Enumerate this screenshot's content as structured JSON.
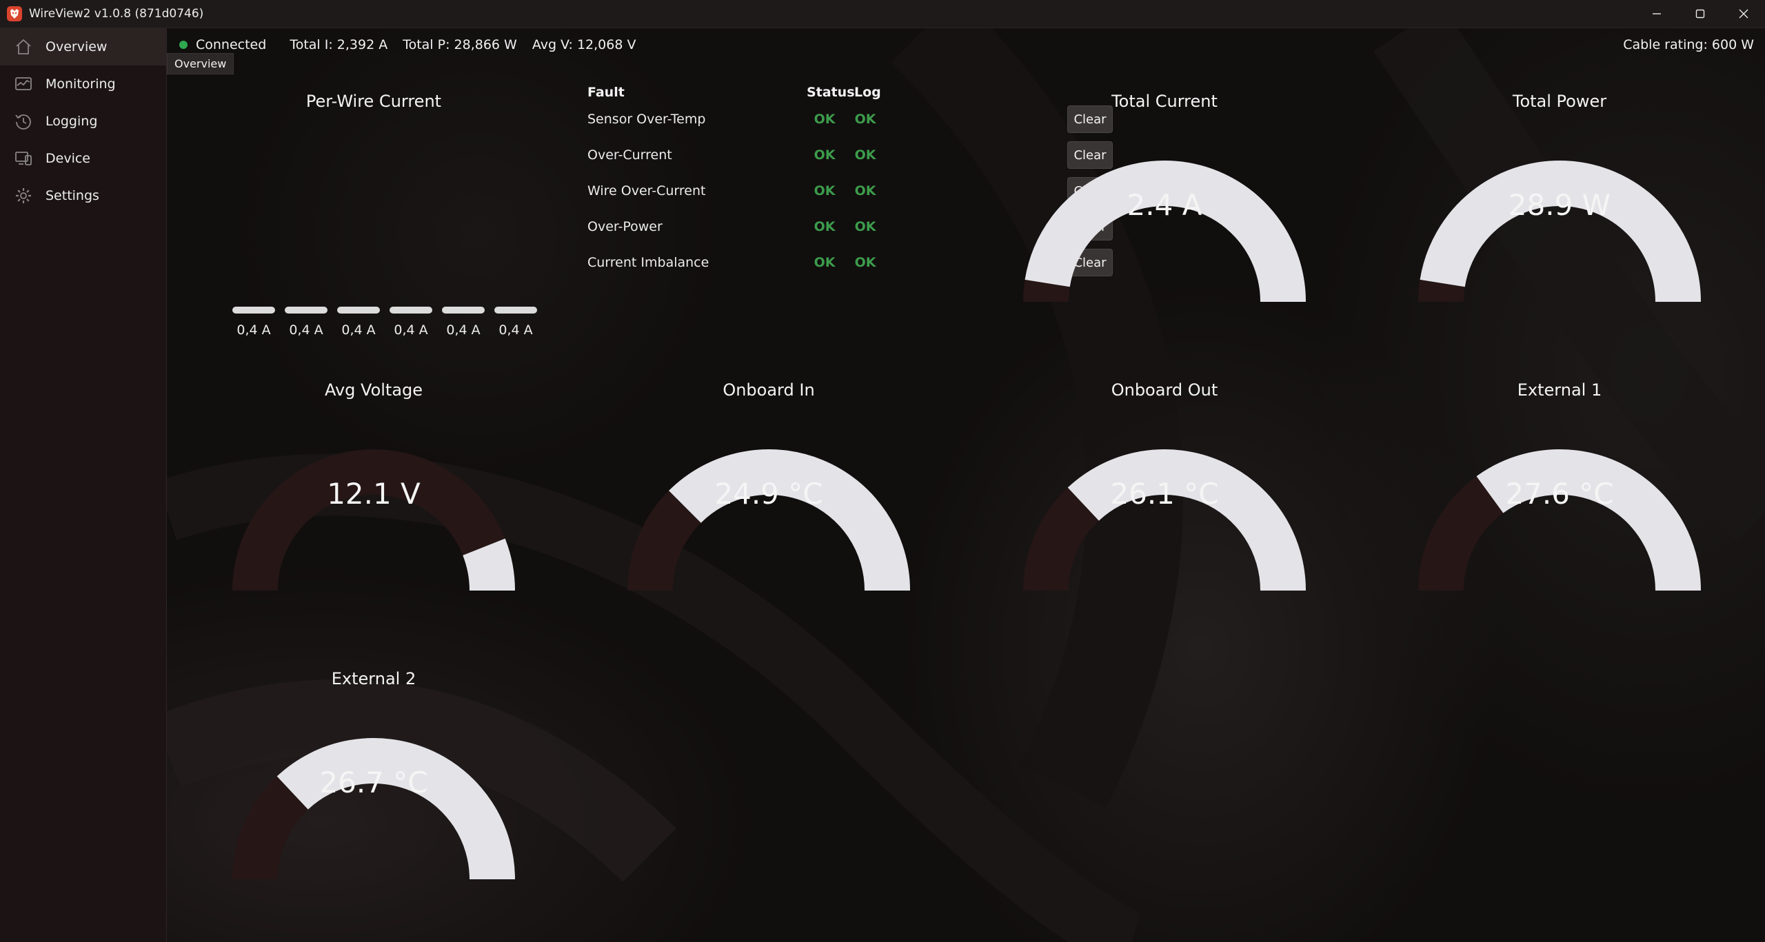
{
  "window": {
    "title": "WireView2 v1.0.8 (871d0746)"
  },
  "sidebar": {
    "items": [
      {
        "label": "Overview",
        "icon": "home-icon"
      },
      {
        "label": "Monitoring",
        "icon": "monitoring-icon"
      },
      {
        "label": "Logging",
        "icon": "history-icon"
      },
      {
        "label": "Device",
        "icon": "device-icon"
      },
      {
        "label": "Settings",
        "icon": "gear-icon"
      }
    ]
  },
  "status": {
    "connection": "Connected",
    "total_current": "Total I: 2,392 A",
    "total_power": "Total P: 28,866 W",
    "avg_voltage": "Avg V: 12,068 V",
    "cable_rating": "Cable rating: 600 W",
    "tooltip": "Overview"
  },
  "colors": {
    "gauge_fill": "#e4e4e8",
    "gauge_track": "#261616",
    "ok": "#3c9c4b",
    "connected": "#2fa84f"
  },
  "per_wire": {
    "title": "Per-Wire Current",
    "wires": [
      {
        "label": "0,4 A",
        "level": 0.4
      },
      {
        "label": "0,4 A",
        "level": 0.4
      },
      {
        "label": "0,4 A",
        "level": 0.4
      },
      {
        "label": "0,4 A",
        "level": 0.36
      },
      {
        "label": "0,4 A",
        "level": 0.4
      },
      {
        "label": "0,4 A",
        "level": 0.44
      }
    ]
  },
  "faults": {
    "headers": {
      "fault": "Fault",
      "status": "Status",
      "log": "Log"
    },
    "clear_label": "Clear",
    "rows": [
      {
        "name": "Sensor Over-Temp",
        "status": "OK",
        "log": "OK"
      },
      {
        "name": "Over-Current",
        "status": "OK",
        "log": "OK"
      },
      {
        "name": "Wire Over-Current",
        "status": "OK",
        "log": "OK"
      },
      {
        "name": "Over-Power",
        "status": "OK",
        "log": "OK"
      },
      {
        "name": "Current Imbalance",
        "status": "OK",
        "log": "OK"
      }
    ]
  },
  "gauges": [
    {
      "title": "Total Current",
      "value": "2.4 A",
      "fill_fraction": 0.95
    },
    {
      "title": "Total Power",
      "value": "28.9 W",
      "fill_fraction": 0.95
    },
    {
      "title": "Avg Voltage",
      "value": "12.1 V",
      "fill_fraction": 0.12
    },
    {
      "title": "Onboard In",
      "value": "24.9 °C",
      "fill_fraction": 0.75
    },
    {
      "title": "Onboard Out",
      "value": "26.1 °C",
      "fill_fraction": 0.74
    },
    {
      "title": "External 1",
      "value": "27.6 °C",
      "fill_fraction": 0.7
    },
    {
      "title": "External 2",
      "value": "26.7 °C",
      "fill_fraction": 0.74
    }
  ]
}
